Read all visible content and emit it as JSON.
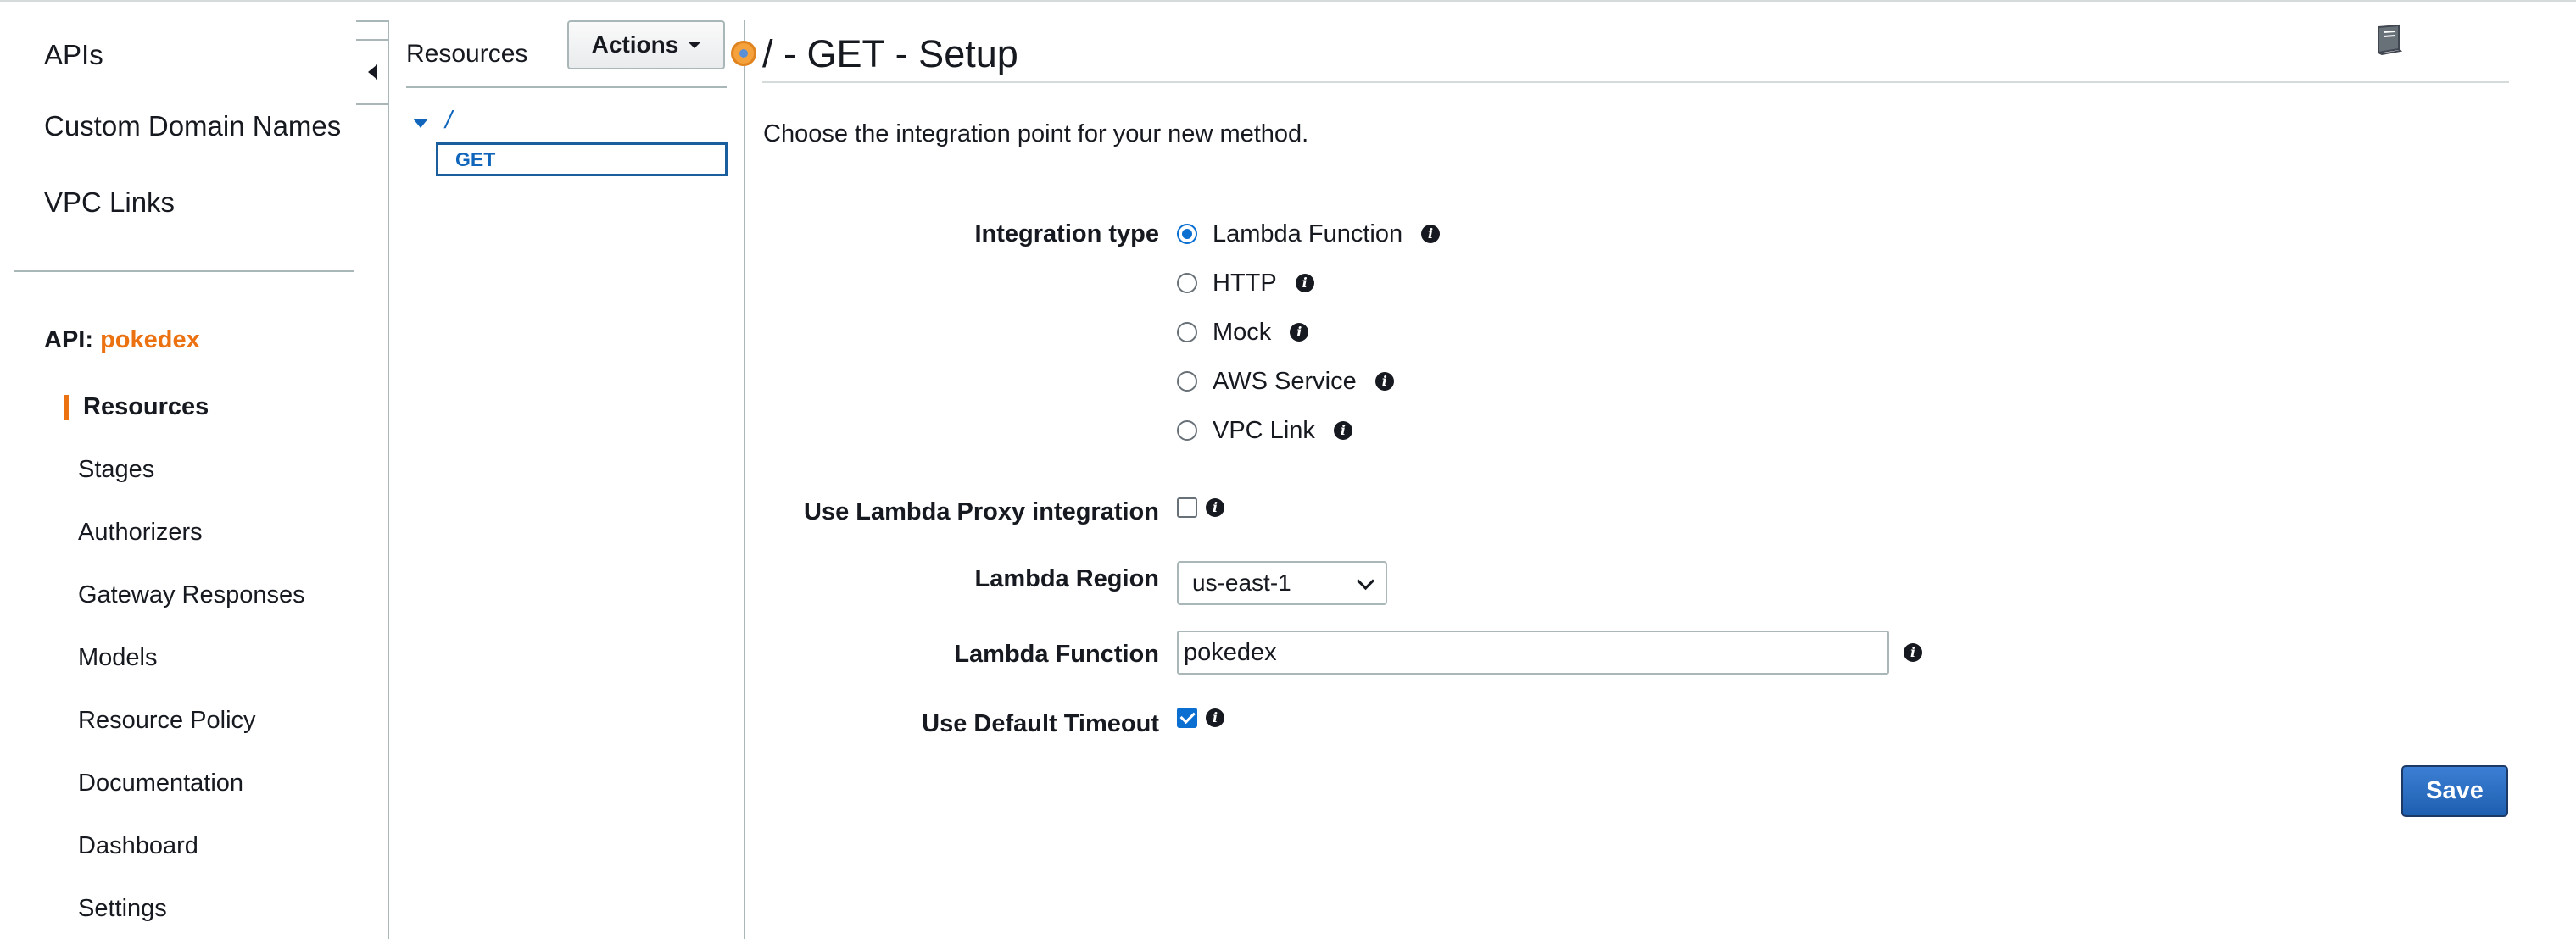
{
  "leftnav": {
    "top_items": [
      {
        "label": "APIs"
      },
      {
        "label": "Custom Domain Names"
      },
      {
        "label": "VPC Links"
      }
    ],
    "api_prefix": "API:",
    "api_name": "pokedex",
    "sub_items": [
      {
        "label": "Resources",
        "active": true
      },
      {
        "label": "Stages"
      },
      {
        "label": "Authorizers"
      },
      {
        "label": "Gateway Responses"
      },
      {
        "label": "Models"
      },
      {
        "label": "Resource Policy"
      },
      {
        "label": "Documentation"
      },
      {
        "label": "Dashboard"
      },
      {
        "label": "Settings"
      }
    ],
    "accent_color": "#ec7211"
  },
  "resources": {
    "title": "Resources",
    "actions_label": "Actions",
    "tree": {
      "root": "/",
      "method": "GET"
    }
  },
  "main": {
    "title": "/ - GET - Setup",
    "intro": "Choose the integration point for your new method.",
    "integration_type": {
      "label": "Integration type",
      "options": [
        {
          "label": "Lambda Function",
          "selected": true
        },
        {
          "label": "HTTP",
          "selected": false
        },
        {
          "label": "Mock",
          "selected": false
        },
        {
          "label": "AWS Service",
          "selected": false
        },
        {
          "label": "VPC Link",
          "selected": false
        }
      ]
    },
    "lambda_proxy": {
      "label": "Use Lambda Proxy integration",
      "checked": false
    },
    "lambda_region": {
      "label": "Lambda Region",
      "value": "us-east-1"
    },
    "lambda_function": {
      "label": "Lambda Function",
      "value": "pokedex"
    },
    "default_timeout": {
      "label": "Use Default Timeout",
      "checked": true
    },
    "save_label": "Save",
    "info_glyph": "i"
  },
  "colors": {
    "link_blue": "#1166bb",
    "primary_button": "#1f5fb0",
    "check_blue": "#0b6fd1"
  }
}
